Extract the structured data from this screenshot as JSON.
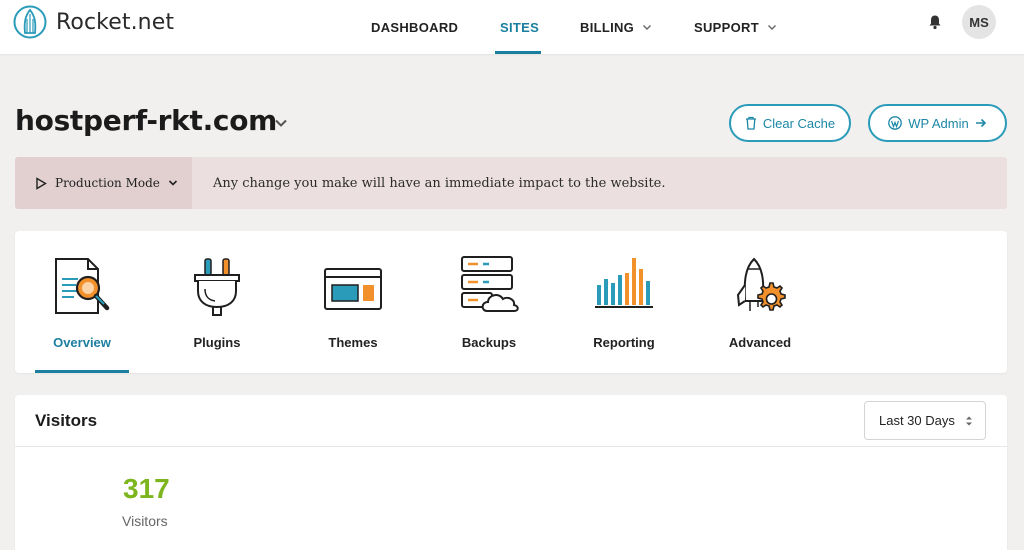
{
  "brand": {
    "name": "Rocket.net"
  },
  "nav": {
    "items": [
      {
        "label": "DASHBOARD"
      },
      {
        "label": "SITES"
      },
      {
        "label": "BILLING"
      },
      {
        "label": "SUPPORT"
      }
    ],
    "active": "SITES",
    "notifications_icon": "bell-icon",
    "user_initials": "MS"
  },
  "site": {
    "domain": "hostperf-rkt.com",
    "actions": {
      "clear_cache": "Clear Cache",
      "wp_admin": "WP Admin"
    }
  },
  "mode": {
    "label": "Production Mode",
    "message": "Any change you make will have an immediate impact to the website."
  },
  "tools": [
    {
      "label": "Overview",
      "icon": "overview-icon",
      "active": true
    },
    {
      "label": "Plugins",
      "icon": "plug-icon"
    },
    {
      "label": "Themes",
      "icon": "themes-icon"
    },
    {
      "label": "Backups",
      "icon": "backups-icon"
    },
    {
      "label": "Reporting",
      "icon": "reporting-icon"
    },
    {
      "label": "Advanced",
      "icon": "advanced-icon"
    }
  ],
  "visitors": {
    "title": "Visitors",
    "range": "Last 30 Days",
    "count": "317",
    "count_label": "Visitors"
  },
  "colors": {
    "accent": "#1a7f9e",
    "orange": "#f2912b",
    "green": "#7cb51e",
    "banner": "#ecdfdf"
  }
}
